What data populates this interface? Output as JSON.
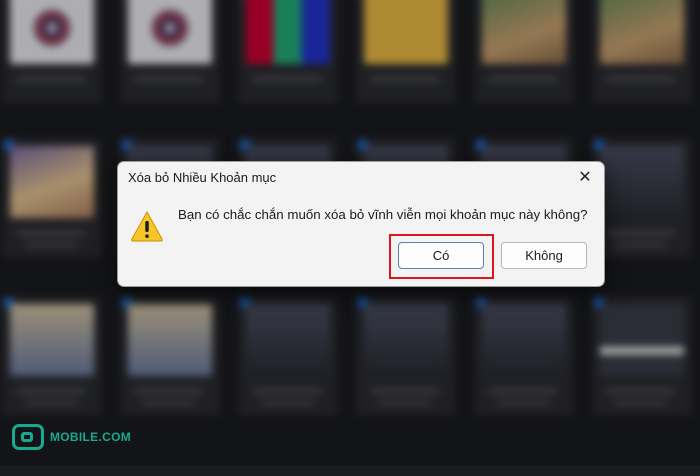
{
  "dialog": {
    "title": "Xóa bỏ Nhiều Khoản mục",
    "close_label": "✕",
    "icon": "warning-icon",
    "message": "Bạn có chắc chắn muốn xóa bỏ vĩnh viễn mọi khoản mục này không?",
    "yes_label": "Có",
    "no_label": "Không"
  },
  "highlight_color": "#d9161f",
  "accent_color": "#19a98f",
  "watermark": {
    "text": "MOBILE.COM"
  }
}
